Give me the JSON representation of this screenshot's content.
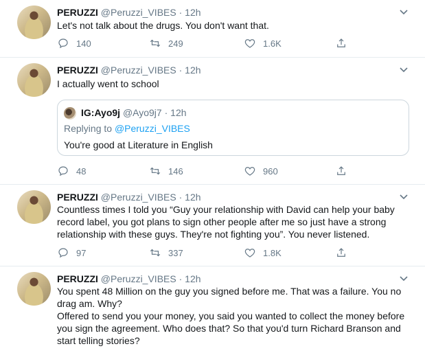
{
  "tweets": [
    {
      "name": "PERUZZI",
      "handle": "@Peruzzi_VIBES",
      "dot": "·",
      "time": "12h",
      "text": "Let's not talk about the drugs. You don't want that.",
      "replies": "140",
      "retweets": "249",
      "likes": "1.6K"
    },
    {
      "name": "PERUZZI",
      "handle": "@Peruzzi_VIBES",
      "dot": "·",
      "time": "12h",
      "text": "I actually went to school",
      "quote": {
        "name": "IG:Ayo9j",
        "handle": "@Ayo9j7",
        "dot": "·",
        "time": "12h",
        "replying_prefix": "Replying to",
        "replying_handle": "@Peruzzi_VIBES",
        "text": "You're good at Literature in English"
      },
      "replies": "48",
      "retweets": "146",
      "likes": "960"
    },
    {
      "name": "PERUZZI",
      "handle": "@Peruzzi_VIBES",
      "dot": "·",
      "time": "12h",
      "text_lines": [
        "Countless times I told you “Guy your relationship with David can help your baby",
        "record label, you got plans to sign other people after me so just have a strong",
        "relationship with these guys. They're not fighting you”. You never listened."
      ],
      "replies": "97",
      "retweets": "337",
      "likes": "1.8K"
    },
    {
      "name": "PERUZZI",
      "handle": "@Peruzzi_VIBES",
      "dot": "·",
      "time": "12h",
      "text_lines": [
        "You spent 48 Million on the guy you signed before me. That was a failure. You no",
        "drag am. Why?",
        "Offered to send you your money, you said you wanted to collect the money before",
        "you sign the agreement. Who does that? So that you'd turn Richard Branson and",
        "start telling stories?"
      ]
    }
  ],
  "icons": {
    "reply": "reply-icon",
    "retweet": "retweet-icon",
    "like": "heart-icon",
    "share": "share-icon",
    "menu": "chevron-down-icon"
  },
  "colors": {
    "text": "#14171a",
    "muted": "#657786",
    "link": "#1da1f2",
    "border": "#e6ecf0"
  }
}
